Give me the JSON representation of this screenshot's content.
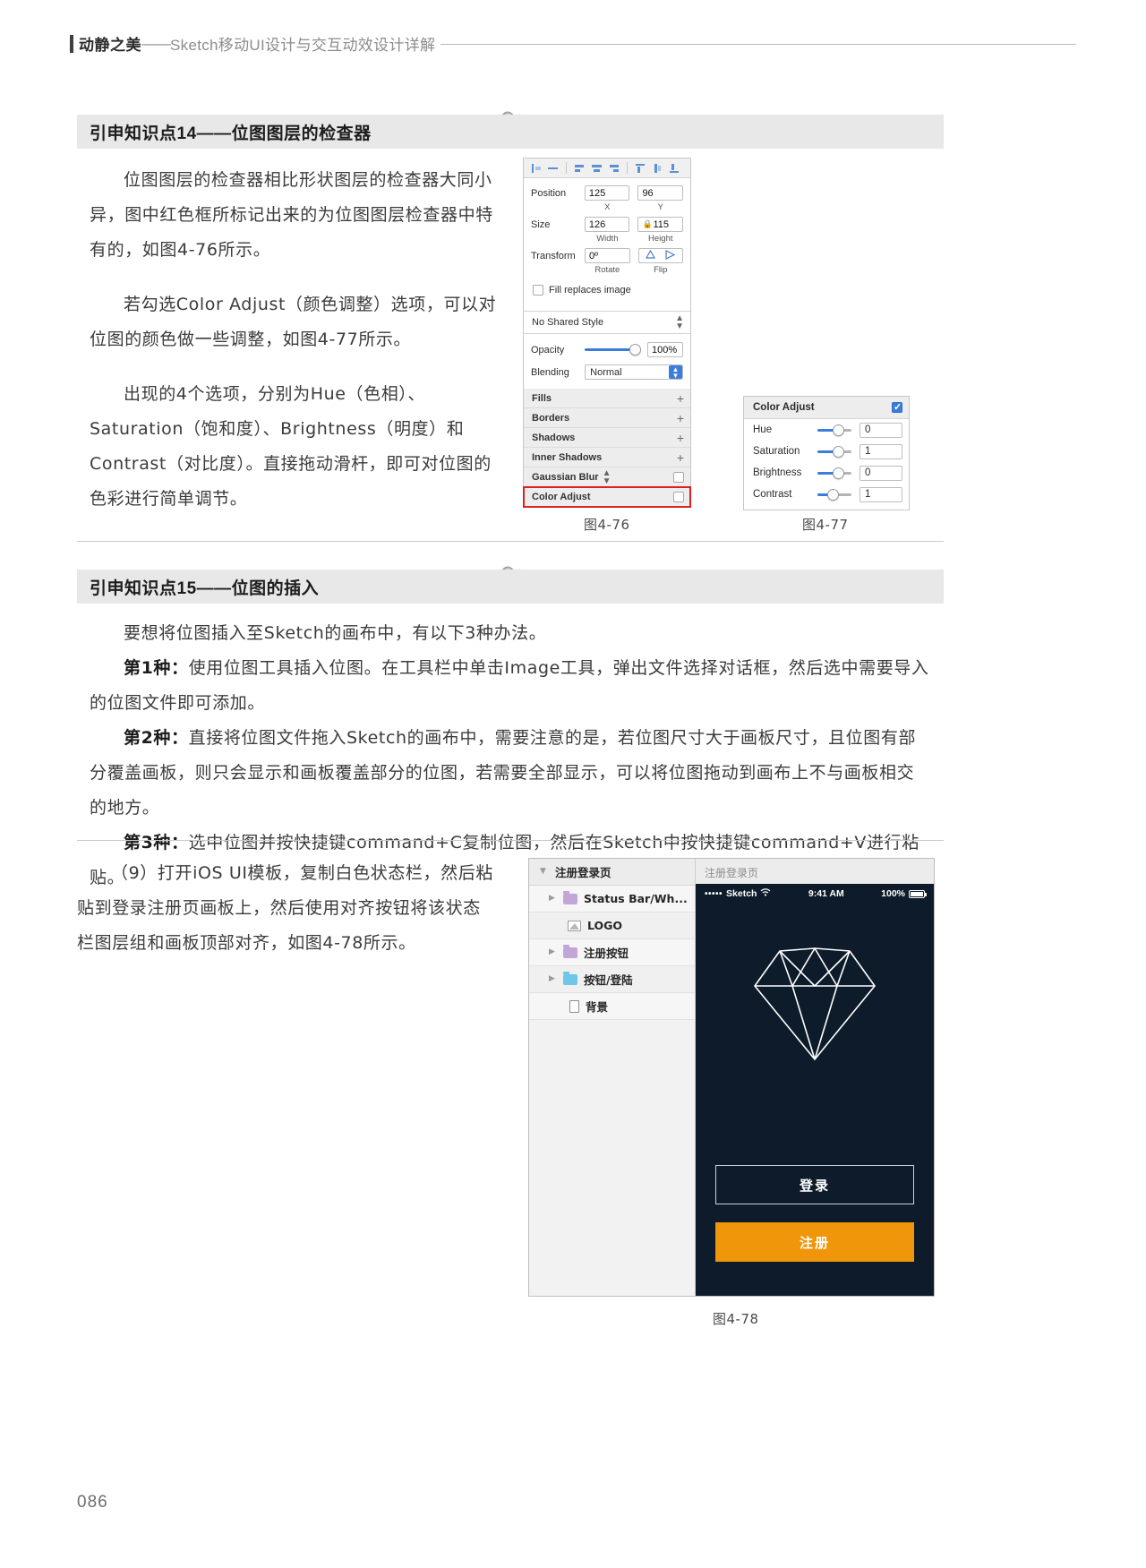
{
  "running_head": {
    "title": "动静之美",
    "dash": "——",
    "subtitle": "Sketch移动UI设计与交互动效设计详解"
  },
  "page_number": "086",
  "tip14": {
    "heading": "引申知识点14——位图图层的检查器",
    "paragraphs": [
      "位图图层的检查器相比形状图层的检查器大同小异，图中红色框所标记出来的为位图图层检查器中特有的，如图4-76所示。",
      "若勾选Color Adjust（颜色调整）选项，可以对位图的颜色做一些调整，如图4-77所示。",
      "出现的4个选项，分别为Hue（色相）、Saturation（饱和度）、Brightness（明度）和Contrast（对比度）。直接拖动滑杆，即可对位图的色彩进行简单调节。"
    ],
    "caption_left": "图4-76",
    "caption_right": "图4-77"
  },
  "inspector": {
    "align_icons": [
      "align-left-icon",
      "align-center-h-icon",
      "distribute-left-icon",
      "distribute-center-icon",
      "distribute-right-icon",
      "align-top-icon",
      "align-middle-icon",
      "align-bottom-icon"
    ],
    "position": {
      "label": "Position",
      "x_value": "125",
      "y_value": "96",
      "x_sub": "X",
      "y_sub": "Y"
    },
    "size": {
      "label": "Size",
      "width_value": "126",
      "height_value": "115",
      "width_sub": "Width",
      "height_sub": "Height",
      "lock_icon": "lock-icon"
    },
    "transform": {
      "label": "Transform",
      "rotate_value": "0º",
      "rotate_sub": "Rotate",
      "flip_sub": "Flip",
      "flip_h_icon": "flip-horizontal-icon",
      "flip_v_icon": "flip-vertical-icon"
    },
    "fill_replaces": "Fill replaces image",
    "shared_style": "No Shared Style",
    "opacity": {
      "label": "Opacity",
      "value": "100%",
      "percent": 88
    },
    "blending": {
      "label": "Blending",
      "value": "Normal"
    },
    "sections": [
      {
        "label": "Fills",
        "control": "plus"
      },
      {
        "label": "Borders",
        "control": "plus"
      },
      {
        "label": "Shadows",
        "control": "plus"
      },
      {
        "label": "Inner Shadows",
        "control": "plus"
      },
      {
        "label": "Gaussian Blur",
        "control": "checkbox",
        "has_stepper": true
      },
      {
        "label": "Color Adjust",
        "control": "checkbox",
        "highlighted": true
      }
    ]
  },
  "color_adjust": {
    "title": "Color Adjust",
    "enabled_icon": "checkbox-checked-icon",
    "rows": [
      {
        "label": "Hue",
        "value": "0",
        "percent": 50
      },
      {
        "label": "Saturation",
        "value": "1",
        "percent": 50
      },
      {
        "label": "Brightness",
        "value": "0",
        "percent": 50
      },
      {
        "label": "Contrast",
        "value": "1",
        "percent": 36
      }
    ]
  },
  "tip15": {
    "heading": "引申知识点15——位图的插入",
    "intro": "要想将位图插入至Sketch的画布中，有以下3种办法。",
    "items": [
      {
        "lead": "第1种：",
        "text": "使用位图工具插入位图。在工具栏中单击Image工具，弹出文件选择对话框，然后选中需要导入的位图文件即可添加。",
        "has_icon": true
      },
      {
        "lead": "第2种：",
        "text": "直接将位图文件拖入Sketch的画布中，需要注意的是，若位图尺寸大于画板尺寸，且位图有部分覆盖画板，则只会显示和画板覆盖部分的位图，若需要全部显示，可以将位图拖动到画布上不与画板相交的地方。",
        "has_icon": false
      },
      {
        "lead": "第3种：",
        "text": "选中位图并按快捷键command+C复制位图，然后在Sketch中按快捷键command+V进行粘贴。",
        "has_icon": false
      }
    ]
  },
  "step9": {
    "text": "（9）打开iOS UI模板，复制白色状态栏，然后粘贴到登录注册页画板上，然后使用对齐按钮将该状态栏图层组和画板顶部对齐，如图4-78所示。",
    "caption": "图4-78"
  },
  "layers": {
    "header": {
      "label": "注册登录页",
      "disclosure_icon": "chevron-down-icon"
    },
    "rows": [
      {
        "label": "Status Bar/Wh...",
        "icon": "folder-icon",
        "color": "#c3a6d8",
        "disclosure": true
      },
      {
        "label": "LOGO",
        "icon": "image-icon",
        "color": "",
        "disclosure": false
      },
      {
        "label": "注册按钮",
        "icon": "folder-icon",
        "color": "#c3a6d8",
        "disclosure": true
      },
      {
        "label": "按钮/登陆",
        "icon": "folder-icon",
        "color": "#6ec6e8",
        "disclosure": true
      },
      {
        "label": "背景",
        "icon": "artboard-icon",
        "color": "",
        "disclosure": false
      }
    ]
  },
  "phone": {
    "canvas_label": "注册登录页",
    "status_bar": {
      "carrier": "Sketch",
      "dots": "•••••",
      "wifi_icon": "wifi-icon",
      "time": "9:41 AM",
      "battery": "100%",
      "battery_icon": "battery-full-icon"
    },
    "logo_icon": "sketch-diamond-icon",
    "login_button": "登录",
    "register_button": "注册",
    "colors": {
      "background": "#0d1b2a",
      "register_button": "#f0960a",
      "login_border": "#c8d3dd"
    }
  }
}
